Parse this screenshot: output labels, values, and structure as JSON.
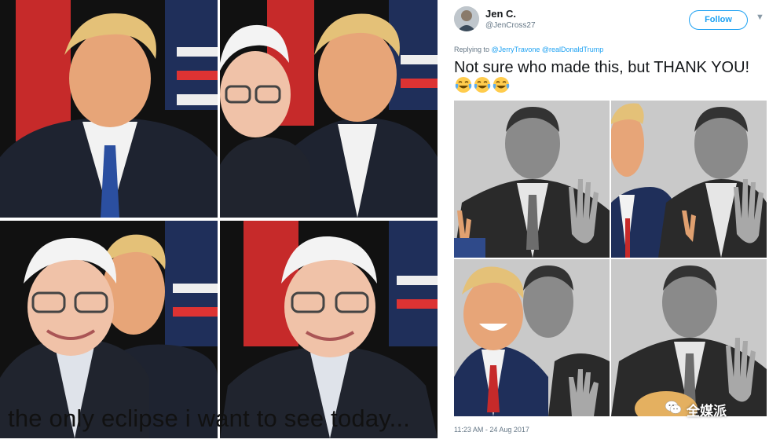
{
  "meme": {
    "caption": "the only eclipse i want to see today...",
    "panels": [
      {
        "name": "meme-panel-trump",
        "description_icon": "portrait-photo"
      },
      {
        "name": "meme-panel-sanders-behind-trump",
        "description_icon": "portrait-photo"
      },
      {
        "name": "meme-panel-trump-behind-sanders",
        "description_icon": "portrait-photo"
      },
      {
        "name": "meme-panel-sanders",
        "description_icon": "portrait-photo"
      }
    ]
  },
  "tweet": {
    "author": {
      "display_name": "Jen C.",
      "handle": "@JenCross27",
      "avatar_icon": "avatar-photo"
    },
    "follow_label": "Follow",
    "menu_icon": "chevron-down-icon",
    "reply": {
      "prefix": "Replying to",
      "mentions": "@JerryTravone @realDonaldTrump"
    },
    "text": "Not sure who made this, but THANK YOU!",
    "emojis": [
      "face-with-tears-of-joy",
      "face-with-tears-of-joy",
      "face-with-tears-of-joy"
    ],
    "timestamp": "11:23 AM - 24 Aug 2017"
  },
  "watermark": {
    "text": "全媒派",
    "icon": "wechat-icon"
  },
  "colors": {
    "accent": "#1da1f2",
    "text_primary": "#14171a",
    "text_secondary": "#657786",
    "flag_red": "#c62a2a",
    "flag_blue": "#1f2f5a",
    "suit": "#1e2330"
  }
}
